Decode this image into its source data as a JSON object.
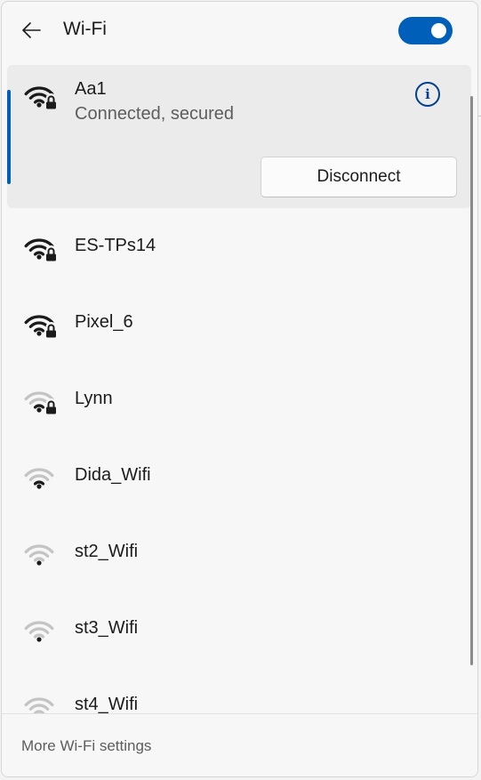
{
  "header": {
    "back_icon": "arrow-left-icon",
    "title": "Wi-Fi",
    "wifi_toggle": {
      "state": "on",
      "color": "#005fb8"
    }
  },
  "connected_network": {
    "name": "Aa1",
    "status": "Connected, secured",
    "signal_bars": 4,
    "secured": true,
    "info_icon": "info-icon",
    "disconnect_label": "Disconnect",
    "accent_color": "#005fb8"
  },
  "networks": [
    {
      "name": "ES-TPs14",
      "signal_bars": 4,
      "secured": true
    },
    {
      "name": "Pixel_6",
      "signal_bars": 4,
      "secured": true
    },
    {
      "name": "Lynn",
      "signal_bars": 2,
      "secured": true
    },
    {
      "name": "Dida_Wifi",
      "signal_bars": 2,
      "secured": false
    },
    {
      "name": "st2_Wifi",
      "signal_bars": 1,
      "secured": false
    },
    {
      "name": "st3_Wifi",
      "signal_bars": 1,
      "secured": false
    },
    {
      "name": "st4_Wifi",
      "signal_bars": 1,
      "secured": false
    }
  ],
  "footer": {
    "settings_link": "More Wi-Fi settings"
  }
}
